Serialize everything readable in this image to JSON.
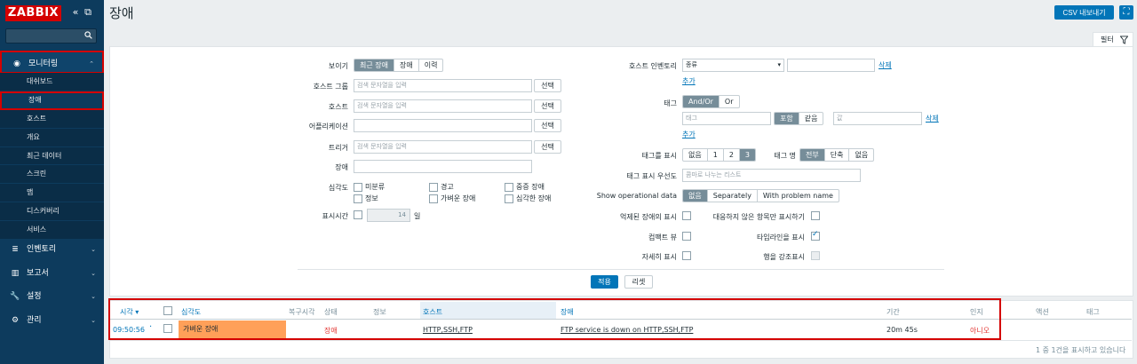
{
  "sidebar": {
    "logo": "ZABBIX",
    "collapse_icon": "«",
    "kiosk_icon": "⧉",
    "main": [
      {
        "label": "모니터링",
        "icon": "eye-icon",
        "glyph": "◉"
      },
      {
        "label": "인벤토리",
        "icon": "list-icon",
        "glyph": "≣"
      },
      {
        "label": "보고서",
        "icon": "chart-icon",
        "glyph": "▥"
      },
      {
        "label": "설정",
        "icon": "wrench-icon",
        "glyph": "🔧"
      },
      {
        "label": "관리",
        "icon": "gear-icon",
        "glyph": "⚙"
      }
    ],
    "submenu": [
      "대쉬보드",
      "장애",
      "호스트",
      "개요",
      "최근 데이터",
      "스크린",
      "맵",
      "디스커버리",
      "서비스"
    ]
  },
  "header": {
    "title": "장애",
    "csv_button": "CSV 내보내기"
  },
  "filter": {
    "tab_label": "필터",
    "show_label": "보이기",
    "show_options": [
      "최근 장애",
      "장애",
      "이력"
    ],
    "host_group_label": "호스트 그룹",
    "host_group_placeholder": "검색 문자열을 입력",
    "host_label": "호스트",
    "host_placeholder": "검색 문자열을 입력",
    "application_label": "어플리케이션",
    "trigger_label": "트리거",
    "trigger_placeholder": "검색 문자열을 입력",
    "problem_label": "장애",
    "severity_label": "심각도",
    "severities": [
      "미분류",
      "정보",
      "경고",
      "가벼운 장애",
      "중증 장애",
      "심각한 장애"
    ],
    "age_label": "표시시간",
    "age_value": "14",
    "age_unit": "일",
    "select_button": "선택",
    "inventory_label": "호스트 인벤토리",
    "inventory_select": "종류",
    "remove_link": "삭제",
    "add_link": "추가",
    "tags_label": "태그",
    "tag_ops": [
      "And/Or",
      "Or"
    ],
    "tag_placeholder": "태그",
    "tag_match": [
      "포함",
      "같음"
    ],
    "tag_value_placeholder": "값",
    "show_tags_label": "태그를 표시",
    "show_tags_options": [
      "없음",
      "1",
      "2",
      "3"
    ],
    "tag_name_label": "태그 명",
    "tag_name_options": [
      "전부",
      "단축",
      "없음"
    ],
    "tag_priority_label": "태그 표시 우선도",
    "tag_priority_placeholder": "콤마로 나누는 리스트",
    "op_data_label": "Show operational data",
    "op_data_options": [
      "없음",
      "Separately",
      "With problem name"
    ],
    "suppressed_label": "억제된 장애의 표시",
    "unack_label": "대응하지 않은 항목만 표시하기",
    "compact_label": "컴팩트 뷰",
    "timeline_label": "타임라인을 표시",
    "details_label": "자세히 표시",
    "highlight_label": "행을 강조표시",
    "apply_button": "적용",
    "reset_button": "리셋"
  },
  "table": {
    "headers": {
      "time": "시각 ▾",
      "severity": "심각도",
      "recovery": "복구시각",
      "status": "상태",
      "info": "정보",
      "host": "호스트",
      "problem": "장애",
      "duration": "기간",
      "ack": "인지",
      "actions": "액션",
      "tags": "태그"
    },
    "rows": [
      {
        "time": "09:50:56",
        "severity": "가벼운 장애",
        "status": "장애",
        "host": "HTTP,SSH,FTP",
        "problem": "FTP service is down on HTTP,SSH,FTP",
        "duration": "20m 45s",
        "ack": "아니오"
      }
    ],
    "footer": "1 중 1건을 표시하고 있습니다"
  },
  "colors": {
    "sidebar": "#0d3b5d",
    "accent": "#0275b8",
    "severity_average": "#ffa059",
    "problem_red": "#e33734"
  }
}
